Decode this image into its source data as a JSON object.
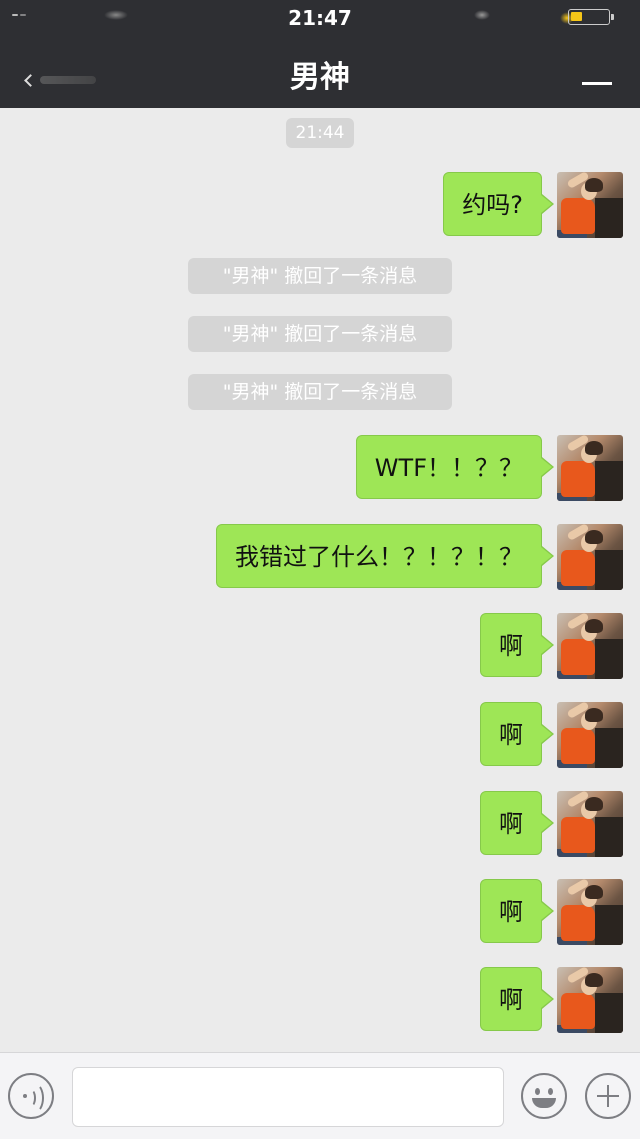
{
  "status_bar": {
    "time": "21:47"
  },
  "header": {
    "title": "男神",
    "back_icon": "chevron-left-icon",
    "menu_icon": "menu-icon"
  },
  "chat": {
    "timestamp": "21:44",
    "notices": [
      "\"男神\" 撤回了一条消息",
      "\"男神\" 撤回了一条消息",
      "\"男神\" 撤回了一条消息"
    ],
    "messages": [
      {
        "text": "约吗?",
        "sender": "me"
      },
      {
        "text": "WTF！！？？",
        "sender": "me"
      },
      {
        "text": "我错过了什么！？！？！？",
        "sender": "me"
      },
      {
        "text": "啊",
        "sender": "me"
      },
      {
        "text": "啊",
        "sender": "me"
      },
      {
        "text": "啊",
        "sender": "me"
      },
      {
        "text": "啊",
        "sender": "me"
      },
      {
        "text": "啊",
        "sender": "me"
      }
    ],
    "bubble_color": "#9ee656"
  },
  "input_bar": {
    "value": "",
    "placeholder": "",
    "voice_icon": "voice-icon",
    "emoji_icon": "emoji-icon",
    "plus_icon": "plus-icon"
  }
}
